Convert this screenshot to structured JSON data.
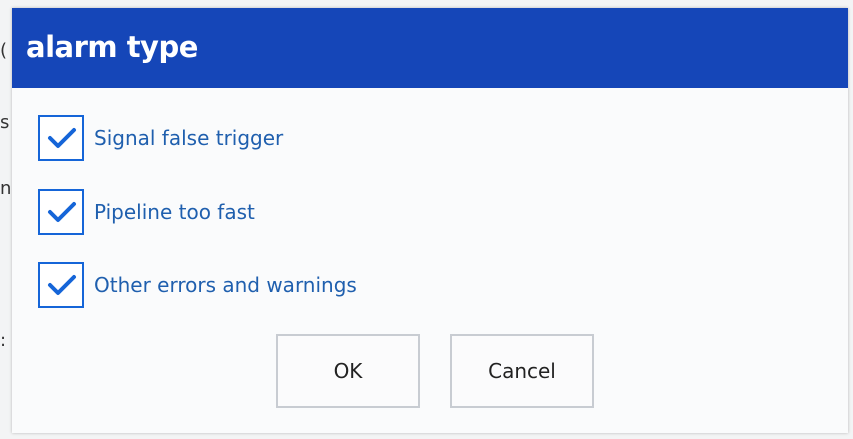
{
  "dialog": {
    "title": "alarm type",
    "options": [
      {
        "label": "Signal false trigger",
        "checked": true
      },
      {
        "label": "Pipeline too fast",
        "checked": true
      },
      {
        "label": "Other errors and warnings",
        "checked": true
      }
    ],
    "ok_label": "OK",
    "cancel_label": "Cancel"
  },
  "colors": {
    "titlebar": "#1546b8",
    "checkbox_accent": "#1565d8",
    "label_text": "#1f5fae"
  },
  "icons": {
    "checkbox_mark": "checkmark-icon"
  }
}
